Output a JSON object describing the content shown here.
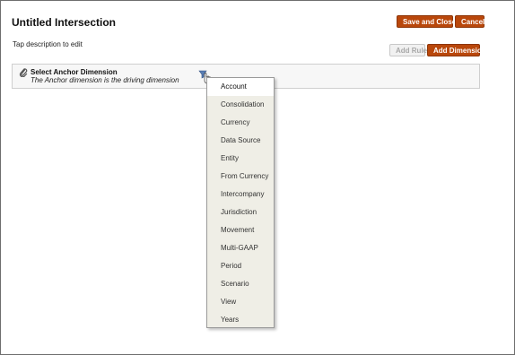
{
  "page": {
    "title": "Untitled Intersection",
    "description": "Tap description to edit"
  },
  "toolbar": {
    "save_close_label": "Save and Close",
    "cancel_label": "Cancel",
    "add_rule_label": "Add Rule",
    "add_dimension_label": "Add Dimension"
  },
  "anchor": {
    "title": "Select Anchor Dimension",
    "subtitle": "The Anchor dimension is the driving dimension",
    "icon": "paperclip-icon",
    "filter_icon": "filter-icon"
  },
  "dimension_menu": {
    "selected": "Account",
    "items": [
      "Account",
      "Consolidation",
      "Currency",
      "Data Source",
      "Entity",
      "From Currency",
      "Intercompany",
      "Jurisdiction",
      "Movement",
      "Multi-GAAP",
      "Period",
      "Scenario",
      "View",
      "Years"
    ]
  },
  "colors": {
    "accent": "#b9470b",
    "menu_bg": "#efeee6",
    "panel_bg": "#f7f7f7"
  }
}
